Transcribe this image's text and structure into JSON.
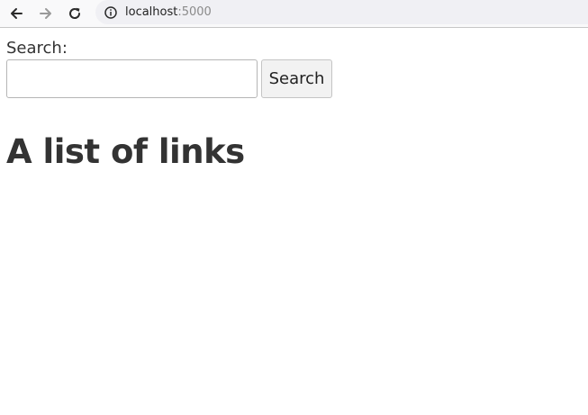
{
  "browser": {
    "url_host": "localhost",
    "url_port": ":5000"
  },
  "search": {
    "label": "Search:",
    "input_value": "",
    "button_label": "Search"
  },
  "main": {
    "heading": "A list of links"
  },
  "icons": {
    "back": "back-arrow-icon",
    "forward": "forward-arrow-icon",
    "reload": "reload-icon",
    "info": "info-icon"
  }
}
